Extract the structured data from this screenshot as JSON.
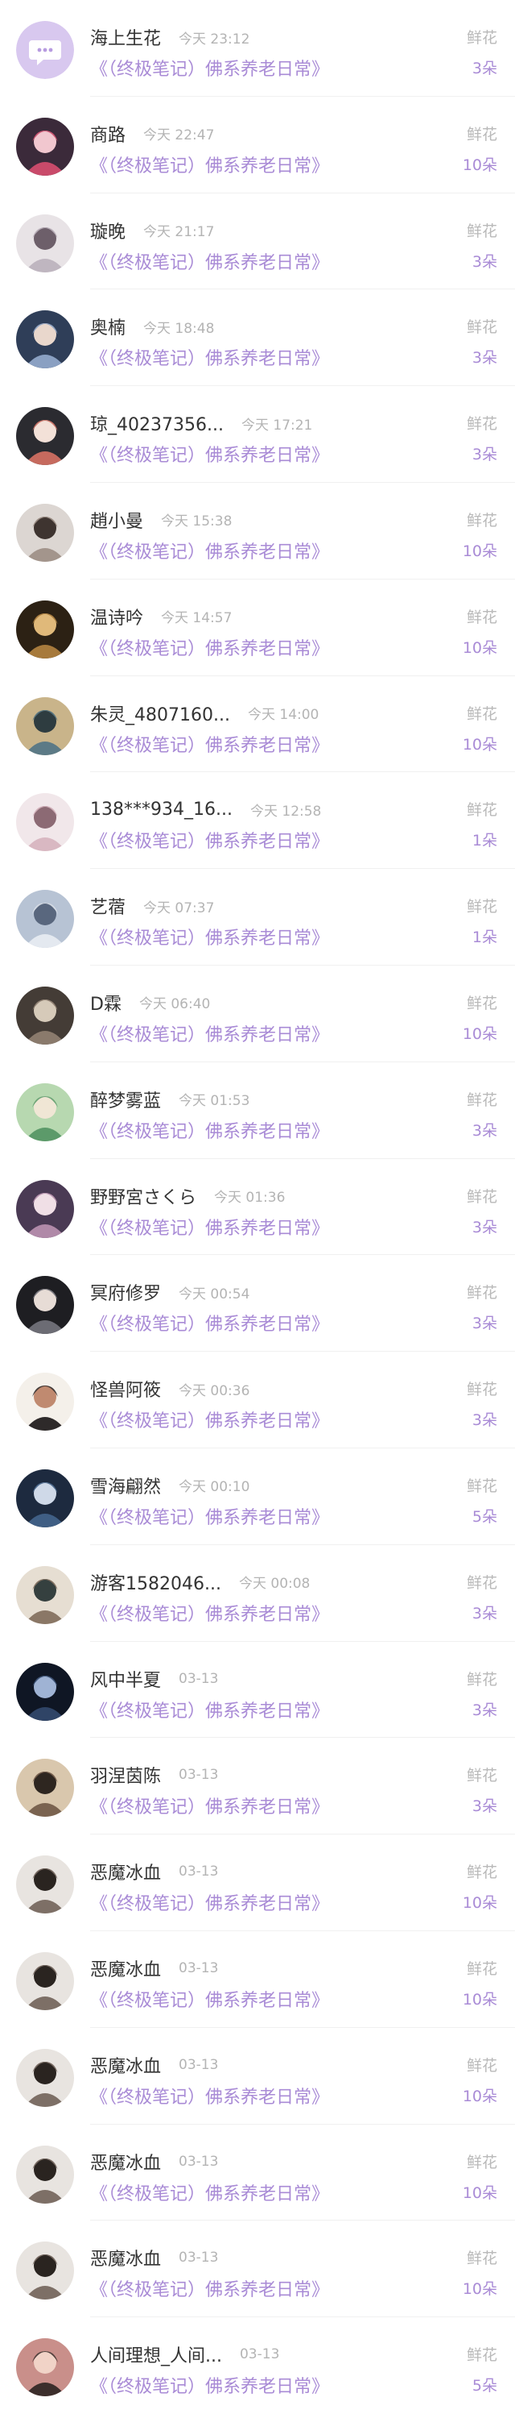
{
  "colors": {
    "accent": "#a98bd6",
    "name": "#333333",
    "muted": "#b4b4b4",
    "divider": "#f0f0f0"
  },
  "rows": [
    {
      "name": "海上生花",
      "time": "今天 23:12",
      "book": "《（终极笔记）佛系养老日常》",
      "gift": "鲜花",
      "count": "3朵",
      "avatar": "default-avatar-icon"
    },
    {
      "name": "商路",
      "time": "今天 22:47",
      "book": "《（终极笔记）佛系养老日常》",
      "gift": "鲜花",
      "count": "10朵",
      "avatar": "user-photo-avatar"
    },
    {
      "name": "璇晚",
      "time": "今天 21:17",
      "book": "《（终极笔记）佛系养老日常》",
      "gift": "鲜花",
      "count": "3朵",
      "avatar": "user-photo-avatar"
    },
    {
      "name": "奥楠",
      "time": "今天 18:48",
      "book": "《（终极笔记）佛系养老日常》",
      "gift": "鲜花",
      "count": "3朵",
      "avatar": "user-photo-avatar"
    },
    {
      "name": "琼_40237356...",
      "time": "今天 17:21",
      "book": "《（终极笔记）佛系养老日常》",
      "gift": "鲜花",
      "count": "3朵",
      "avatar": "user-photo-avatar"
    },
    {
      "name": "趙小曼",
      "time": "今天 15:38",
      "book": "《（终极笔记）佛系养老日常》",
      "gift": "鲜花",
      "count": "10朵",
      "avatar": "user-photo-avatar"
    },
    {
      "name": "温诗吟",
      "time": "今天 14:57",
      "book": "《（终极笔记）佛系养老日常》",
      "gift": "鲜花",
      "count": "10朵",
      "avatar": "user-photo-avatar"
    },
    {
      "name": "朱灵_4807160...",
      "time": "今天 14:00",
      "book": "《（终极笔记）佛系养老日常》",
      "gift": "鲜花",
      "count": "10朵",
      "avatar": "user-photo-avatar"
    },
    {
      "name": "138***934_16...",
      "time": "今天 12:58",
      "book": "《（终极笔记）佛系养老日常》",
      "gift": "鲜花",
      "count": "1朵",
      "avatar": "user-photo-avatar"
    },
    {
      "name": "艺蓿",
      "time": "今天 07:37",
      "book": "《（终极笔记）佛系养老日常》",
      "gift": "鲜花",
      "count": "1朵",
      "avatar": "user-photo-avatar"
    },
    {
      "name": "D霖",
      "time": "今天 06:40",
      "book": "《（终极笔记）佛系养老日常》",
      "gift": "鲜花",
      "count": "10朵",
      "avatar": "user-photo-avatar"
    },
    {
      "name": "醉梦雾蓝",
      "time": "今天 01:53",
      "book": "《（终极笔记）佛系养老日常》",
      "gift": "鲜花",
      "count": "3朵",
      "avatar": "user-photo-avatar"
    },
    {
      "name": "野野宮さくら",
      "time": "今天 01:36",
      "book": "《（终极笔记）佛系养老日常》",
      "gift": "鲜花",
      "count": "3朵",
      "avatar": "user-photo-avatar"
    },
    {
      "name": "冥府修罗",
      "time": "今天 00:54",
      "book": "《（终极笔记）佛系养老日常》",
      "gift": "鲜花",
      "count": "3朵",
      "avatar": "user-photo-avatar"
    },
    {
      "name": "怪兽阿筱",
      "time": "今天 00:36",
      "book": "《（终极笔记）佛系养老日常》",
      "gift": "鲜花",
      "count": "3朵",
      "avatar": "user-photo-avatar"
    },
    {
      "name": "雪海翩然",
      "time": "今天 00:10",
      "book": "《（终极笔记）佛系养老日常》",
      "gift": "鲜花",
      "count": "5朵",
      "avatar": "user-photo-avatar"
    },
    {
      "name": "游客1582046...",
      "time": "今天 00:08",
      "book": "《（终极笔记）佛系养老日常》",
      "gift": "鲜花",
      "count": "3朵",
      "avatar": "user-photo-avatar"
    },
    {
      "name": "风中半夏",
      "time": "03-13",
      "book": "《（终极笔记）佛系养老日常》",
      "gift": "鲜花",
      "count": "3朵",
      "avatar": "user-photo-avatar"
    },
    {
      "name": "羽涅茵陈",
      "time": "03-13",
      "book": "《（终极笔记）佛系养老日常》",
      "gift": "鲜花",
      "count": "3朵",
      "avatar": "user-photo-avatar"
    },
    {
      "name": "恶魔冰血",
      "time": "03-13",
      "book": "《（终极笔记）佛系养老日常》",
      "gift": "鲜花",
      "count": "10朵",
      "avatar": "user-photo-avatar"
    },
    {
      "name": "恶魔冰血",
      "time": "03-13",
      "book": "《（终极笔记）佛系养老日常》",
      "gift": "鲜花",
      "count": "10朵",
      "avatar": "user-photo-avatar"
    },
    {
      "name": "恶魔冰血",
      "time": "03-13",
      "book": "《（终极笔记）佛系养老日常》",
      "gift": "鲜花",
      "count": "10朵",
      "avatar": "user-photo-avatar"
    },
    {
      "name": "恶魔冰血",
      "time": "03-13",
      "book": "《（终极笔记）佛系养老日常》",
      "gift": "鲜花",
      "count": "10朵",
      "avatar": "user-photo-avatar"
    },
    {
      "name": "恶魔冰血",
      "time": "03-13",
      "book": "《（终极笔记）佛系养老日常》",
      "gift": "鲜花",
      "count": "10朵",
      "avatar": "user-photo-avatar"
    },
    {
      "name": "人间理想_人间...",
      "time": "03-13",
      "book": "《（终极笔记）佛系养老日常》",
      "gift": "鲜花",
      "count": "5朵",
      "avatar": "user-photo-avatar"
    }
  ]
}
